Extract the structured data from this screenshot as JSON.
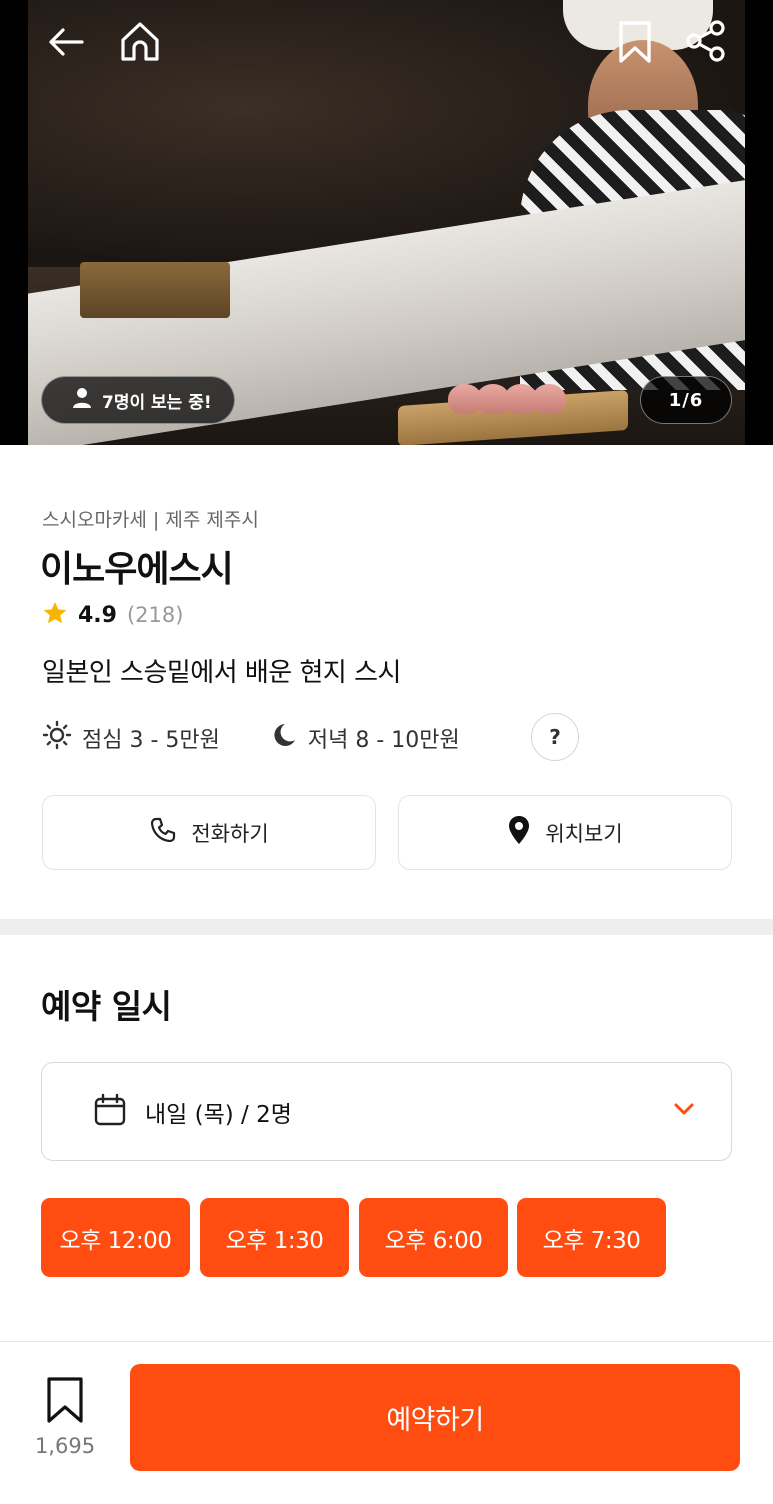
{
  "hero": {
    "viewer_text": "7명이 보는 중!",
    "photo_counter": "1/6",
    "icons": [
      "back-arrow-icon",
      "home-icon",
      "bookmark-icon",
      "share-icon"
    ]
  },
  "restaurant": {
    "category": "스시오마카세 | 제주 제주시",
    "name": "이노우에스시",
    "rating": "4.9",
    "review_count": "(218)",
    "tagline": "일본인 스승밑에서 배운 현지 스시",
    "lunch_price": "점심 3 - 5만원",
    "dinner_price": "저녁 8 - 10만원",
    "help_label": "?"
  },
  "actions": {
    "call_label": "전화하기",
    "map_label": "위치보기"
  },
  "reservation": {
    "section_title": "예약 일시",
    "selected": "내일 (목) / 2명",
    "time_slots": [
      "오후 12:00",
      "오후 1:30",
      "오후 6:00",
      "오후 7:30"
    ]
  },
  "bottom": {
    "save_count": "1,695",
    "reserve_label": "예약하기"
  },
  "colors": {
    "accent": "#ff4d12",
    "star": "#f7b500",
    "divider": "#eeeeee"
  }
}
